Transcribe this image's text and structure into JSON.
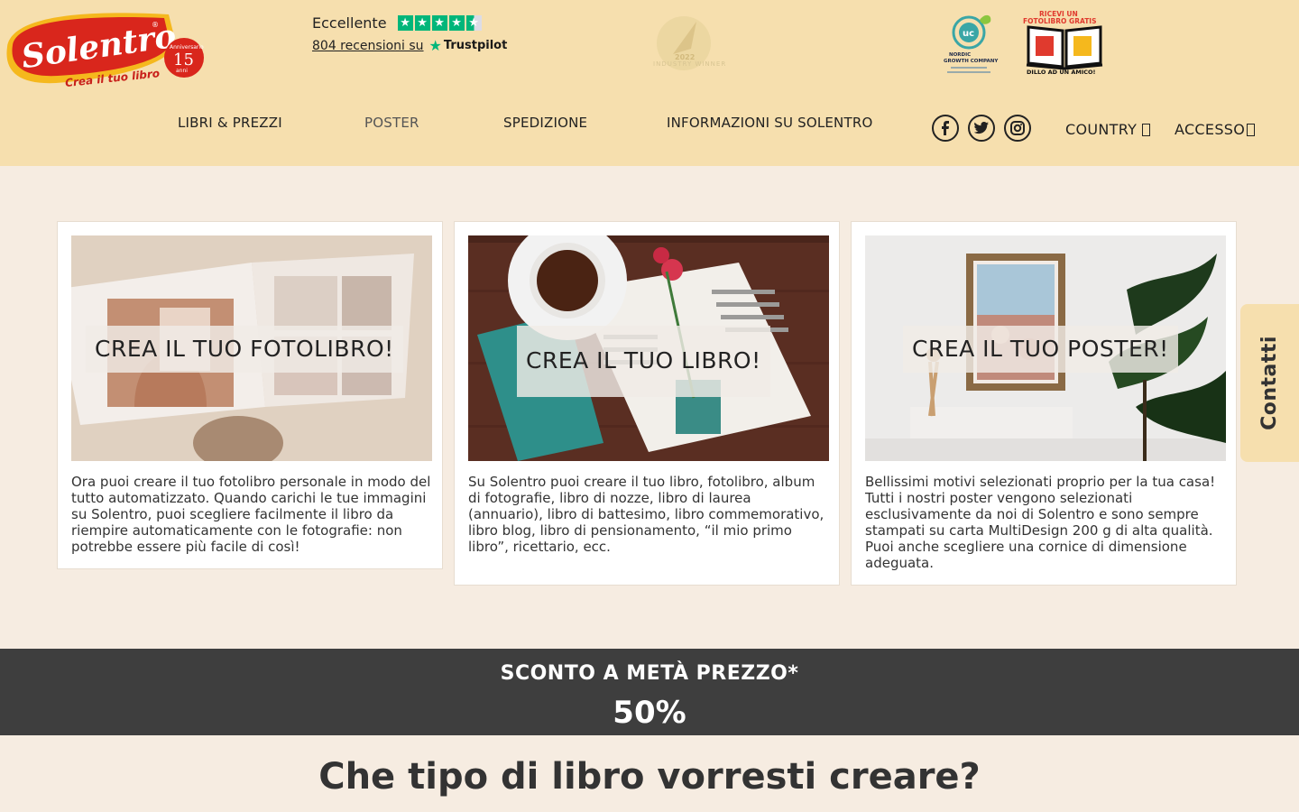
{
  "header": {
    "logo": {
      "brand": "Solentro",
      "tagline": "Crea il tuo libro",
      "anniversary_number": "15",
      "anniversary_text": "Anniversario anni"
    },
    "trustpilot": {
      "rating_label": "Eccellente",
      "reviews_link": "804 recensioni su",
      "brand": "Trustpilot",
      "stars": 4.5
    },
    "badges": {
      "award_text": "INDUSTRY WINNER",
      "nordic_text": "NORDIC GROWTH COMPANY",
      "freebook_top": "RICEVI UN FOTOLIBRO GRATIS",
      "freebook_bottom": "DILLO AD UN AMICO!"
    },
    "nav": [
      "LIBRI & PREZZI",
      "POSTER",
      "SPEDIZIONE",
      "INFORMAZIONI SU SOLENTRO"
    ],
    "social": [
      "facebook-icon",
      "twitter-icon",
      "instagram-icon"
    ],
    "country_label": "COUNTRY",
    "login_label": "ACCESSO"
  },
  "cards": [
    {
      "caption": "CREA IL TUO FOTOLIBRO!",
      "text": "Ora puoi creare il tuo fotolibro personale in modo del tutto automatizzato. Quando carichi le tue immagini su Solentro, puoi scegliere facilmente il libro da riempire automaticamente con le fotografie: non potrebbe essere più facile di così!"
    },
    {
      "caption": "CREA IL TUO LIBRO!",
      "text": "Su Solentro puoi creare il tuo libro, fotolibro, album di fotografie, libro di nozze, libro di laurea (annuario), libro di battesimo, libro commemorativo, libro blog, libro di pensionamento, “il mio primo libro”, ricettario, ecc."
    },
    {
      "caption": "CREA IL TUO POSTER!",
      "text": "Bellissimi motivi selezionati proprio per la tua casa! Tutti i nostri poster vengono selezionati esclusivamente da noi di Solentro e sono sempre stampati su carta MultiDesign 200 g di alta qualità. Puoi anche scegliere una cornice di dimensione adeguata."
    }
  ],
  "contact_tab": "Contatti",
  "promo": {
    "title": "SCONTO A METÀ PREZZO*",
    "value": "50%"
  },
  "question": "Che tipo di libro vorresti creare?",
  "colors": {
    "header_bg": "#f6dfae",
    "page_bg": "#f6ece1",
    "promo_bg": "#3e3e3e",
    "logo_red": "#d9261c",
    "logo_yellow": "#f5b81d",
    "trust_green": "#00b67a"
  }
}
